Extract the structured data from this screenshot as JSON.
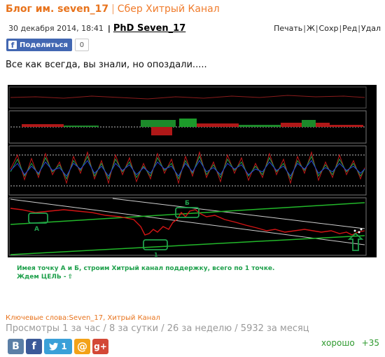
{
  "header": {
    "blog_label": "Блог им. seven_17",
    "separator": "|",
    "post_title": "Сбер Хитрый Канал"
  },
  "meta": {
    "date": "30 декабря 2014, 18:41",
    "separator": "|",
    "author": "PhD Seven_17"
  },
  "actions": [
    "Печать",
    "Ж",
    "Сохр",
    "Ред",
    "Удал"
  ],
  "share": {
    "label": "Поделиться",
    "count": "0"
  },
  "post": {
    "text": "Все как всегда, вы знали, но опоздали....."
  },
  "chart_annotations": {
    "label_a": "А",
    "label_b": "Б",
    "label_1": "1",
    "caption_line1": "Имея точку А и Б, строим Хитрый канал поддержку, всего по 1 точке.",
    "caption_line2": "Ждем ЦЕЛЬ -"
  },
  "footer": {
    "keywords": "Ключевые слова:Seven_17, Хитрый Канал",
    "stats": "Просмотры 1 за час / 8 за сутки / 26 за неделю / 5932 за месяц",
    "rating_label": "хорошо",
    "rating_score": "+35"
  },
  "social": {
    "vk": "B",
    "fb": "f",
    "tw_count": "1",
    "mail": "@",
    "gplus": "g+"
  },
  "colors": {
    "accent": "#e8731c",
    "caption_green": "#1fa04c",
    "rating_green": "#2e9a2e",
    "fb_blue": "#4267b2"
  }
}
